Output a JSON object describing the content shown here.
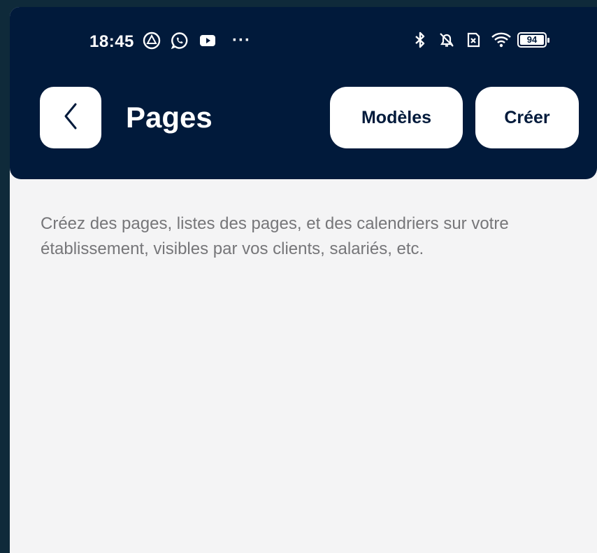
{
  "status_bar": {
    "time": "18:45",
    "more_indicator": "···",
    "battery_level": "94",
    "left_icons": [
      "drive-icon",
      "whatsapp-icon",
      "youtube-icon"
    ],
    "right_icons": [
      "bluetooth-icon",
      "bell-off-icon",
      "sim-icon",
      "wifi-icon",
      "battery-icon"
    ]
  },
  "header": {
    "title": "Pages",
    "back_icon": "chevron-left-icon",
    "templates_label": "Modèles",
    "create_label": "Créer",
    "background_color": "#011a3b"
  },
  "main": {
    "description": "Créez des pages, listes des pages, et des calendriers sur votre établissement, visibles par vos clients, salariés, etc.",
    "background_color": "#f4f4f5"
  }
}
